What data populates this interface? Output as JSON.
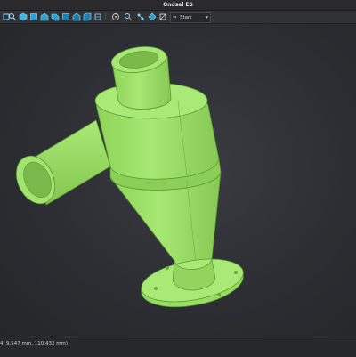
{
  "window": {
    "title": "Ondsel ES"
  },
  "toolbar": {
    "icons": [
      "fit-all-icon",
      "zoom-icon",
      "view-iso-icon",
      "view-front-icon",
      "view-top-icon",
      "view-right-icon",
      "view-rear-icon",
      "view-bottom-icon",
      "view-left-icon",
      "measure-icon",
      "document-icon",
      "tree-icon",
      "part-icon",
      "clipping-icon"
    ],
    "view_select": {
      "value": "Start"
    }
  },
  "status": {
    "coordinates": "4, 9.547 mm, 110.432 mm)"
  },
  "colors": {
    "model": "#9ee06a",
    "model_edge": "#4f8f2a",
    "background": "#2b2d31"
  }
}
